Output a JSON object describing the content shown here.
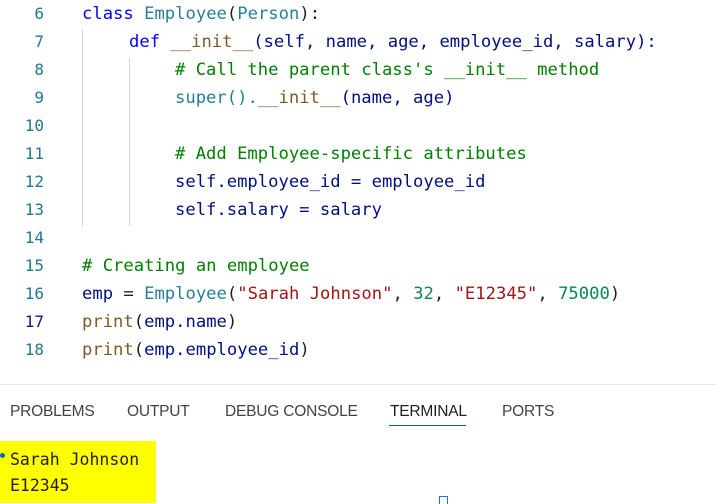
{
  "editor": {
    "lines": [
      {
        "n": "6"
      },
      {
        "n": "7"
      },
      {
        "n": "8"
      },
      {
        "n": "9"
      },
      {
        "n": "10"
      },
      {
        "n": "11"
      },
      {
        "n": "12"
      },
      {
        "n": "13"
      },
      {
        "n": "14"
      },
      {
        "n": "15"
      },
      {
        "n": "16"
      },
      {
        "n": "17"
      },
      {
        "n": "18"
      }
    ],
    "active_line": "17",
    "tokens": {
      "l6_class": "class",
      "l6_name": "Employee",
      "l6_paren_open": "(",
      "l6_base": "Person",
      "l6_paren_close": "):",
      "l7_def": "def",
      "l7_init": "__init__",
      "l7_params": "(self, name, age, employee_id, salary):",
      "l8_comment": "# Call the parent class's __init__ method",
      "l9_super": "super",
      "l9_call": "().",
      "l9_init": "__init__",
      "l9_args": "(name, age)",
      "l11_comment": "# Add Employee-specific attributes",
      "l12_code": "self.employee_id = employee_id",
      "l13_code": "self.salary = salary",
      "l15_comment": "# Creating an employee",
      "l16_emp": "emp",
      "l16_eq": " = ",
      "l16_cls": "Employee",
      "l16_open": "(",
      "l16_s1": "\"Sarah Johnson\"",
      "l16_c1": ", ",
      "l16_n1": "32",
      "l16_c2": ", ",
      "l16_s2": "\"E12345\"",
      "l16_c3": ", ",
      "l16_n2": "75000",
      "l16_close": ")",
      "l17_print": "print",
      "l17_open": "(",
      "l17_arg": "emp.name",
      "l17_close": ")",
      "l18_print": "print",
      "l18_open": "(",
      "l18_arg": "emp.employee_id",
      "l18_close": ")"
    }
  },
  "panel": {
    "tabs": [
      "PROBLEMS",
      "OUTPUT",
      "DEBUG CONSOLE",
      "TERMINAL",
      "PORTS"
    ],
    "active_tab": "TERMINAL"
  },
  "terminal": {
    "output": [
      "Sarah Johnson",
      "E12345"
    ],
    "highlight_color": "#ffff00"
  },
  "colors": {
    "keyword": "#0000ff",
    "class": "#267f99",
    "function": "#795e26",
    "variable": "#001080",
    "comment": "#008000",
    "string": "#a31515",
    "number": "#098658",
    "line_number": "#237893",
    "active_tab_underline": "#005fb8"
  }
}
